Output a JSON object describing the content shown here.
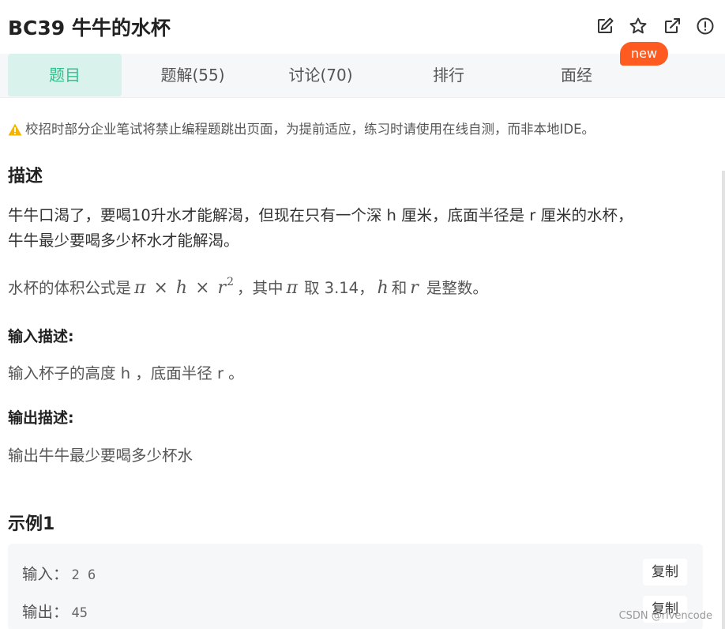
{
  "header": {
    "title": "BC39  牛牛的水杯",
    "new_badge": "new",
    "icons": [
      "edit-icon",
      "star-icon",
      "open-external-icon",
      "warning-circle-icon"
    ]
  },
  "tabs": [
    {
      "label": "题目",
      "active": true
    },
    {
      "label": "题解(55)",
      "active": false
    },
    {
      "label": "讨论(70)",
      "active": false
    },
    {
      "label": "排行",
      "active": false
    },
    {
      "label": "面经",
      "active": false
    }
  ],
  "notice": {
    "icon": "warning-triangle-icon",
    "text": "校招时部分企业笔试将禁止编程题跳出页面，为提前适应，练习时请使用在线自测，而非本地IDE。"
  },
  "description": {
    "heading": "描述",
    "line1": "牛牛口渴了，要喝10升水才能解渴，但现在只有一个深 h 厘米，底面半径是 r 厘米的水杯，",
    "line2": "牛牛最少要喝多少杯水才能解渴。",
    "formula": {
      "prefix": "水杯的体积公式是",
      "pi": "π",
      "times": "×",
      "h": "h",
      "r": "r",
      "exp": "2",
      "mid": "，其中",
      "take": "取 3.14，",
      "and": "和",
      "suffix": "是整数。"
    }
  },
  "input_desc": {
    "heading": "输入描述:",
    "text": "输入杯子的高度 h ，底面半径 r 。"
  },
  "output_desc": {
    "heading": "输出描述:",
    "text": "输出牛牛最少要喝多少杯水"
  },
  "example": {
    "heading": "示例1",
    "input_label": "输入：",
    "input_value": "2 6",
    "output_label": "输出：",
    "output_value": "45",
    "copy_label": "复制"
  },
  "watermark": "CSDN @rivencode",
  "colors": {
    "accent": "#32c08e",
    "active_tab_bg": "#d9f3ec",
    "badge": "#ff5a1f",
    "warning": "#f5b400"
  }
}
